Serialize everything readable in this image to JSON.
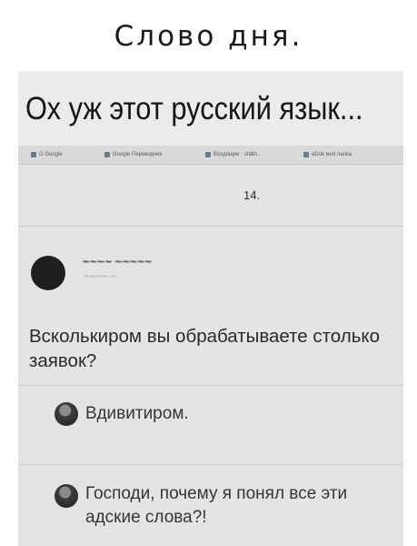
{
  "header": {
    "title": "Слово дня."
  },
  "banner": {
    "text": "Ох уж этот русский язык..."
  },
  "bookmarks_bar": {
    "items": [
      {
        "label": "G Google",
        "icon": "google-icon"
      },
      {
        "label": "Google Переводчик",
        "icon": "translate-icon"
      },
      {
        "label": "Входящие · sfaltn...",
        "icon": "mail-icon"
      },
      {
        "label": "eDok моя папка",
        "icon": "folder-icon"
      }
    ]
  },
  "post": {
    "number": "14.",
    "author_scribble": "~~~~ ~~~~~",
    "author_sub_scribble": "~~~~ ~",
    "question": "Всколькиром вы обрабатываете столько заявок?"
  },
  "replies": [
    {
      "text": "Вдивитиром."
    },
    {
      "text": "Господи, почему я понял все эти адские слова?!"
    }
  ]
}
